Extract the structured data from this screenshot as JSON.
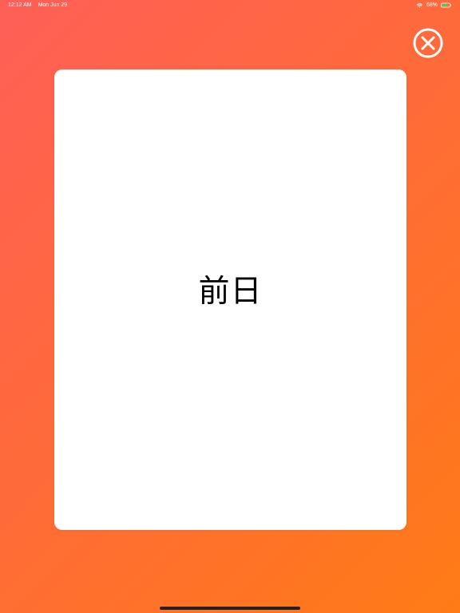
{
  "status_bar": {
    "time": "12:12 AM",
    "date": "Mon Jun 29",
    "battery_percent_label": "68%"
  },
  "card": {
    "word": "前日"
  },
  "icons": {
    "close": "close-icon",
    "wifi": "wifi-icon",
    "battery": "battery-icon"
  },
  "colors": {
    "gradient_start": "#ff5f57",
    "gradient_end": "#ff7b16",
    "card_background": "#ffffff",
    "text": "#000000"
  }
}
